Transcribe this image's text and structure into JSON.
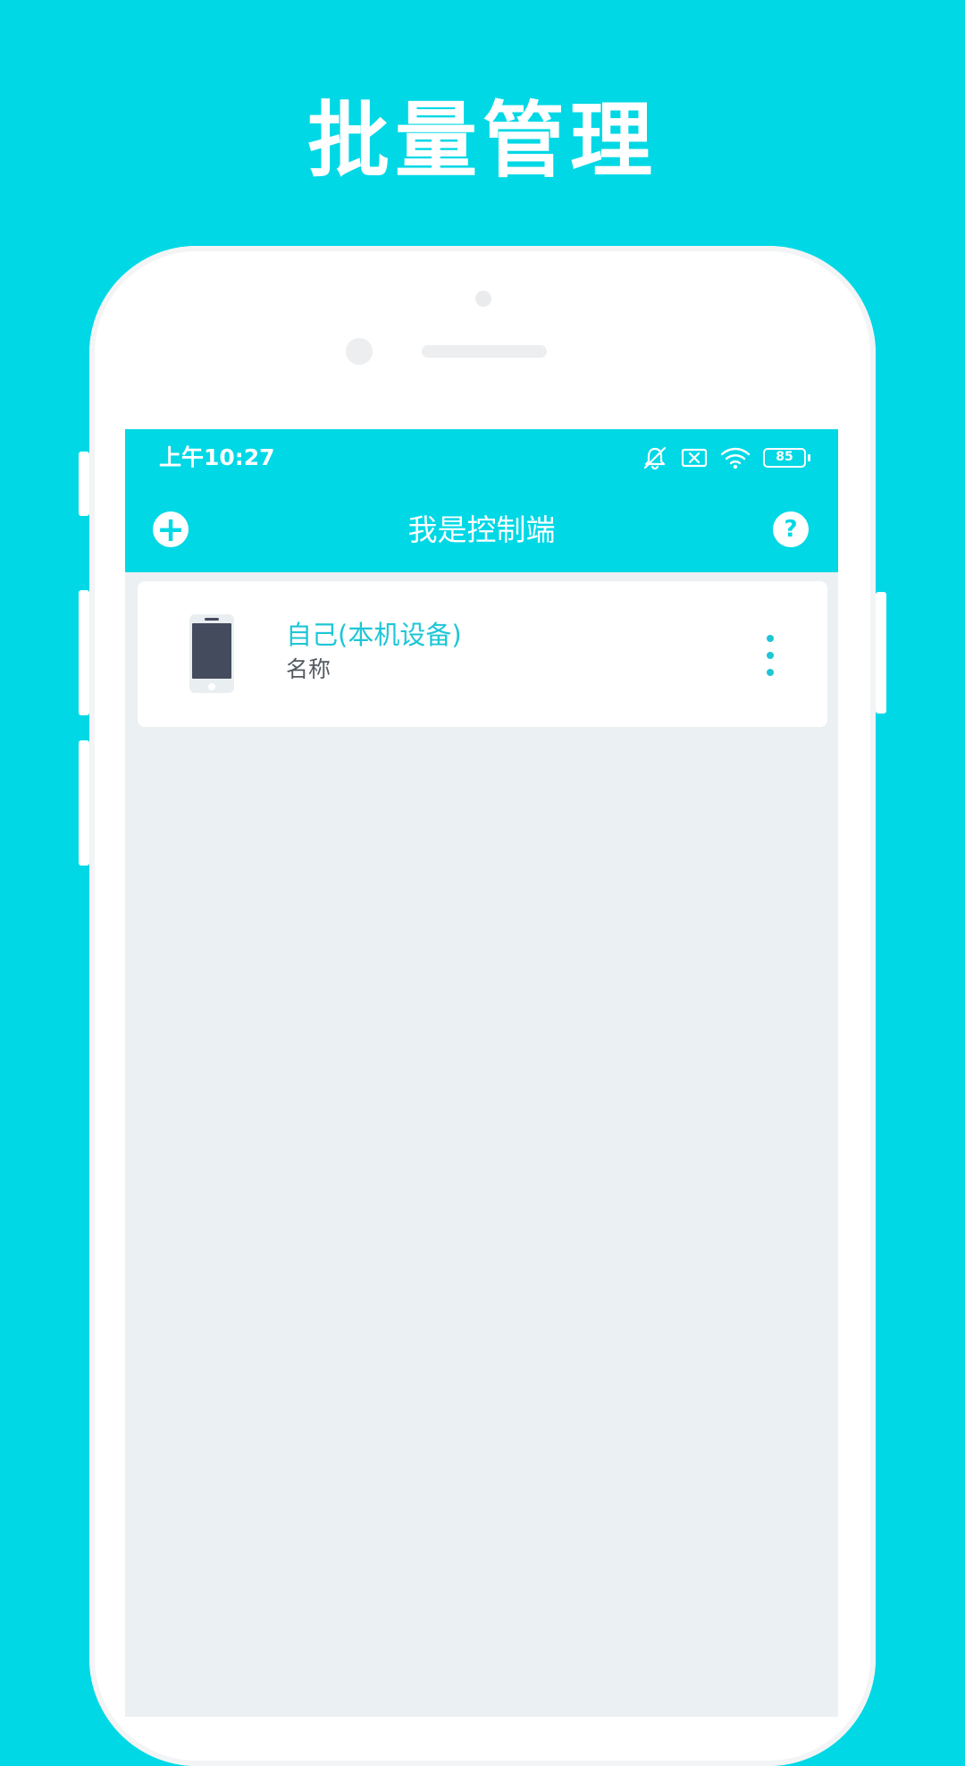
{
  "headline": "批量管理",
  "colors": {
    "brand": "#00D8E6",
    "accent_text": "#1EC6D6",
    "screen_background": "#EBF0F3"
  },
  "status_bar": {
    "time": "上午10:27",
    "icons": [
      "bell-mute-icon",
      "no-sim-icon",
      "wifi-icon",
      "battery-icon"
    ],
    "battery_level": "85"
  },
  "app_bar": {
    "title": "我是控制端",
    "left_icon": "add-icon",
    "left_symbol": "+",
    "right_icon": "help-icon",
    "right_symbol": "?"
  },
  "devices": [
    {
      "name": "自己(本机设备)",
      "subtitle": "名称",
      "icon": "phone-device-icon",
      "menu_icon": "more-vertical-icon"
    }
  ]
}
